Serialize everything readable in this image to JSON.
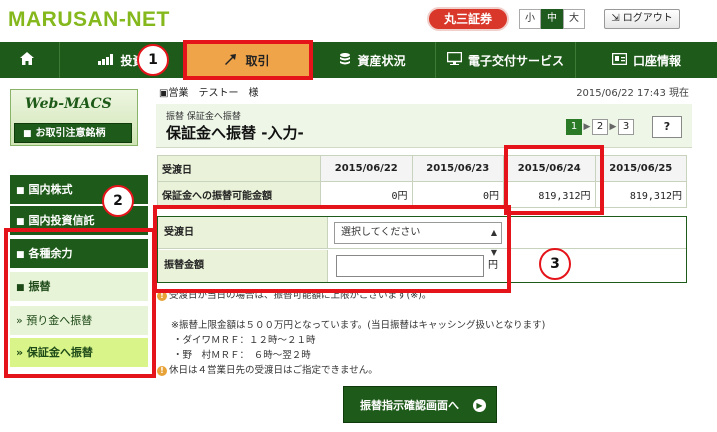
{
  "header": {
    "logo": "MARUSAN-NET",
    "brand": "丸三証券",
    "font_sizes": [
      "小",
      "中",
      "大"
    ],
    "active_font_size": "中",
    "logout": "ログアウト"
  },
  "nav": {
    "items": [
      {
        "label": "",
        "icon": "home-icon"
      },
      {
        "label": "投資",
        "icon": "chart-icon"
      },
      {
        "label": "取引",
        "icon": "arrows-icon"
      },
      {
        "label": "資産状況",
        "icon": "coins-icon"
      },
      {
        "label": "電子交付サービス",
        "icon": "monitor-icon"
      },
      {
        "label": "口座情報",
        "icon": "id-card-icon"
      }
    ],
    "active": "取引"
  },
  "sidebar": {
    "promo_title": "Web-MACS",
    "promo_button": "お取引注意銘柄",
    "items": [
      {
        "label": "国内株式"
      },
      {
        "label": "国内投資信託"
      },
      {
        "label": "各種余力"
      },
      {
        "label": "振替"
      },
      {
        "label": "» 預り金へ振替"
      },
      {
        "label": "» 保証金へ振替"
      }
    ]
  },
  "user": {
    "label": "営業　テストー　様",
    "timestamp": "2015/06/22 17:43 現在"
  },
  "page": {
    "breadcrumb": "振替 保証金へ振替",
    "title": "保証金へ振替 -入力-",
    "steps": [
      "1",
      "2",
      "3"
    ],
    "help": "?"
  },
  "table": {
    "row1_label": "受渡日",
    "row2_label": "保証金への振替可能金額",
    "dates": [
      "2015/06/22",
      "2015/06/23",
      "2015/06/24",
      "2015/06/25"
    ],
    "amounts": [
      "0円",
      "0円",
      "819,312円",
      "819,312円"
    ]
  },
  "form": {
    "date_label": "受渡日",
    "date_select": "選択してください",
    "amount_label": "振替金額",
    "amount_unit": "円",
    "amount_value": ""
  },
  "notes": {
    "line1": "受渡日が当日の場合は、振替可能額に上限がございます(※)。",
    "line2": "※振替上限金額は５００万円となっています。(当日振替はキャッシング扱いとなります)",
    "line3": "・ダイワＭＲＦ：１２時～２１時",
    "line4": "・野　村ＭＲＦ：　６時～翌２時",
    "line5": "休日は４営業日先の受渡日はご指定できません。"
  },
  "submit": {
    "label": "振替指示確認画面へ"
  },
  "callouts": [
    "1",
    "2",
    "3"
  ],
  "colors": {
    "nav_green": "#1e5a19",
    "active_orange": "#f0a44a",
    "highlight_red": "#e5141b",
    "logo_green": "#84b81d"
  }
}
